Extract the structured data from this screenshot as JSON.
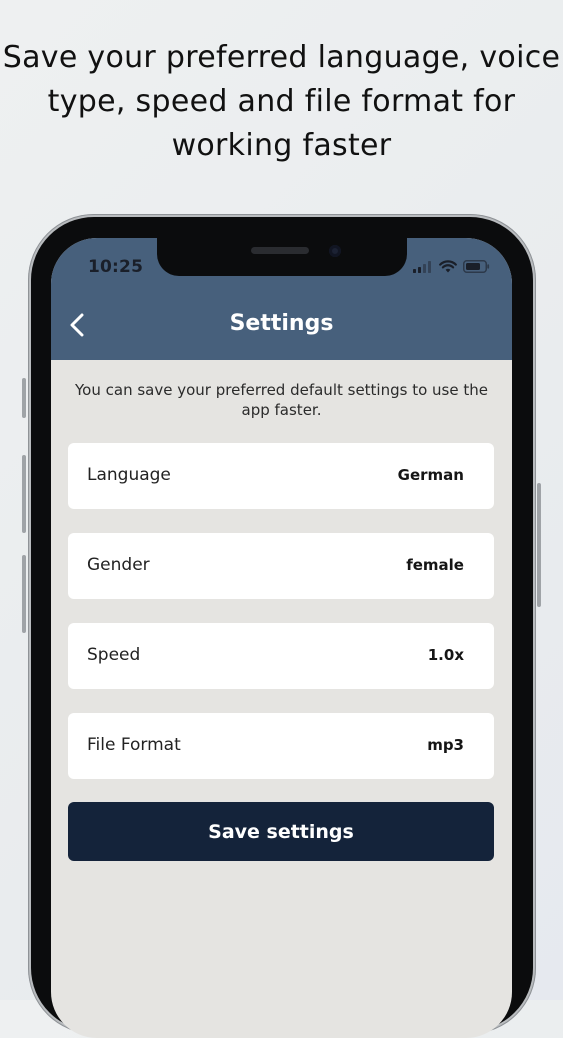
{
  "headline": {
    "line1": "Save your preferred language, voice",
    "line2": "type, speed and file format for",
    "line3": "working faster"
  },
  "status_bar": {
    "time": "10:25",
    "icons": [
      "signal-icon",
      "wifi-icon",
      "battery-icon"
    ]
  },
  "appbar": {
    "title": "Settings",
    "back_icon": "chevron-left-icon"
  },
  "description": "You can save your preferred default settings to use the app faster.",
  "settings": [
    {
      "label": "Language",
      "value": "German"
    },
    {
      "label": "Gender",
      "value": "female"
    },
    {
      "label": "Speed",
      "value": "1.0x"
    },
    {
      "label": "File Format",
      "value": "mp3"
    }
  ],
  "save_button": {
    "label": "Save settings"
  },
  "colors": {
    "appbar": "#47607c",
    "screen_background": "#e5e4e1",
    "card": "#ffffff",
    "primary_button": "#14233a"
  }
}
